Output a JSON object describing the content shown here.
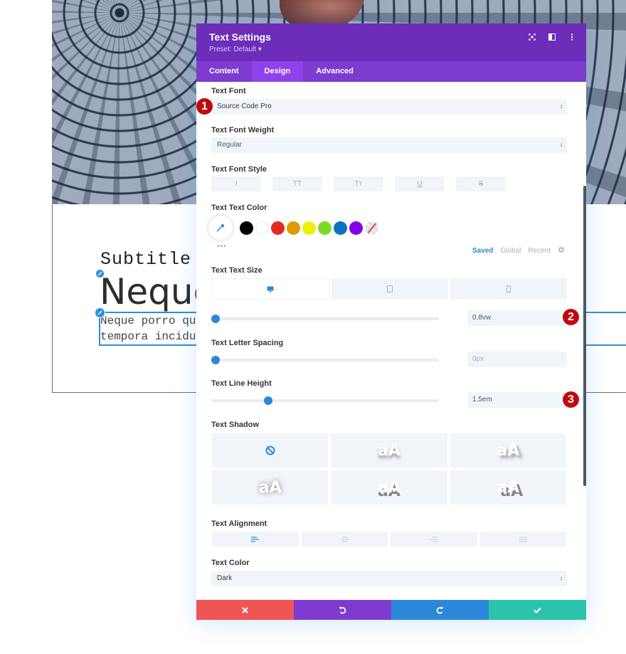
{
  "page_content": {
    "subtitle": "Subtitle",
    "heading": "Neque",
    "body_line1": "Neque porro qui                                                                    ur, ad",
    "body_line2": "tempora incidur"
  },
  "panel": {
    "title": "Text Settings",
    "preset": "Preset: Default ▾",
    "header_icons": [
      "focus-icon",
      "split-view-icon",
      "more-options-icon"
    ],
    "tabs": [
      {
        "label": "Content",
        "active": false
      },
      {
        "label": "Design",
        "active": true
      },
      {
        "label": "Advanced",
        "active": false
      }
    ]
  },
  "fields": {
    "text_font": {
      "label": "Text Font",
      "value": "Source Code Pro"
    },
    "text_font_weight": {
      "label": "Text Font Weight",
      "value": "Regular"
    },
    "text_font_style": {
      "label": "Text Font Style",
      "buttons": [
        "I",
        "TT",
        "Tᴛ",
        "U",
        "S"
      ]
    },
    "text_text_color": {
      "label": "Text Text Color",
      "swatches": [
        "#000000",
        "#ffffff",
        "#e02b20",
        "#e09900",
        "#edf000",
        "#7cda24",
        "#0c71c3",
        "#8300e9"
      ],
      "more": "•••",
      "tabs": [
        "Saved",
        "Global",
        "Recent"
      ],
      "active_tab": "Saved"
    },
    "text_text_size": {
      "label": "Text Text Size",
      "value": "0.8vw",
      "slider_fraction": 0.02
    },
    "text_letter_spacing": {
      "label": "Text Letter Spacing",
      "placeholder": "0px",
      "slider_fraction": 0.02
    },
    "text_line_height": {
      "label": "Text Line Height",
      "value": "1.5em",
      "slider_fraction": 0.25
    },
    "text_shadow": {
      "label": "Text Shadow",
      "preview_text": "aA",
      "options": 6
    },
    "text_alignment": {
      "label": "Text Alignment",
      "options": [
        "left",
        "center",
        "right",
        "justify"
      ],
      "active": "left"
    },
    "text_color": {
      "label": "Text Color",
      "value": "Dark"
    }
  },
  "footer": {
    "buttons": [
      {
        "name": "discard",
        "color": "#ef5555"
      },
      {
        "name": "undo",
        "color": "#7e3bd0"
      },
      {
        "name": "redo",
        "color": "#2b87da"
      },
      {
        "name": "save",
        "color": "#29c4a9"
      }
    ]
  },
  "annotations": [
    "1",
    "2",
    "3"
  ],
  "colors": {
    "header": "#6c2eb9",
    "tabs": "#7e3bd0",
    "active_tab": "#8f42ec",
    "accent": "#2b87da"
  }
}
